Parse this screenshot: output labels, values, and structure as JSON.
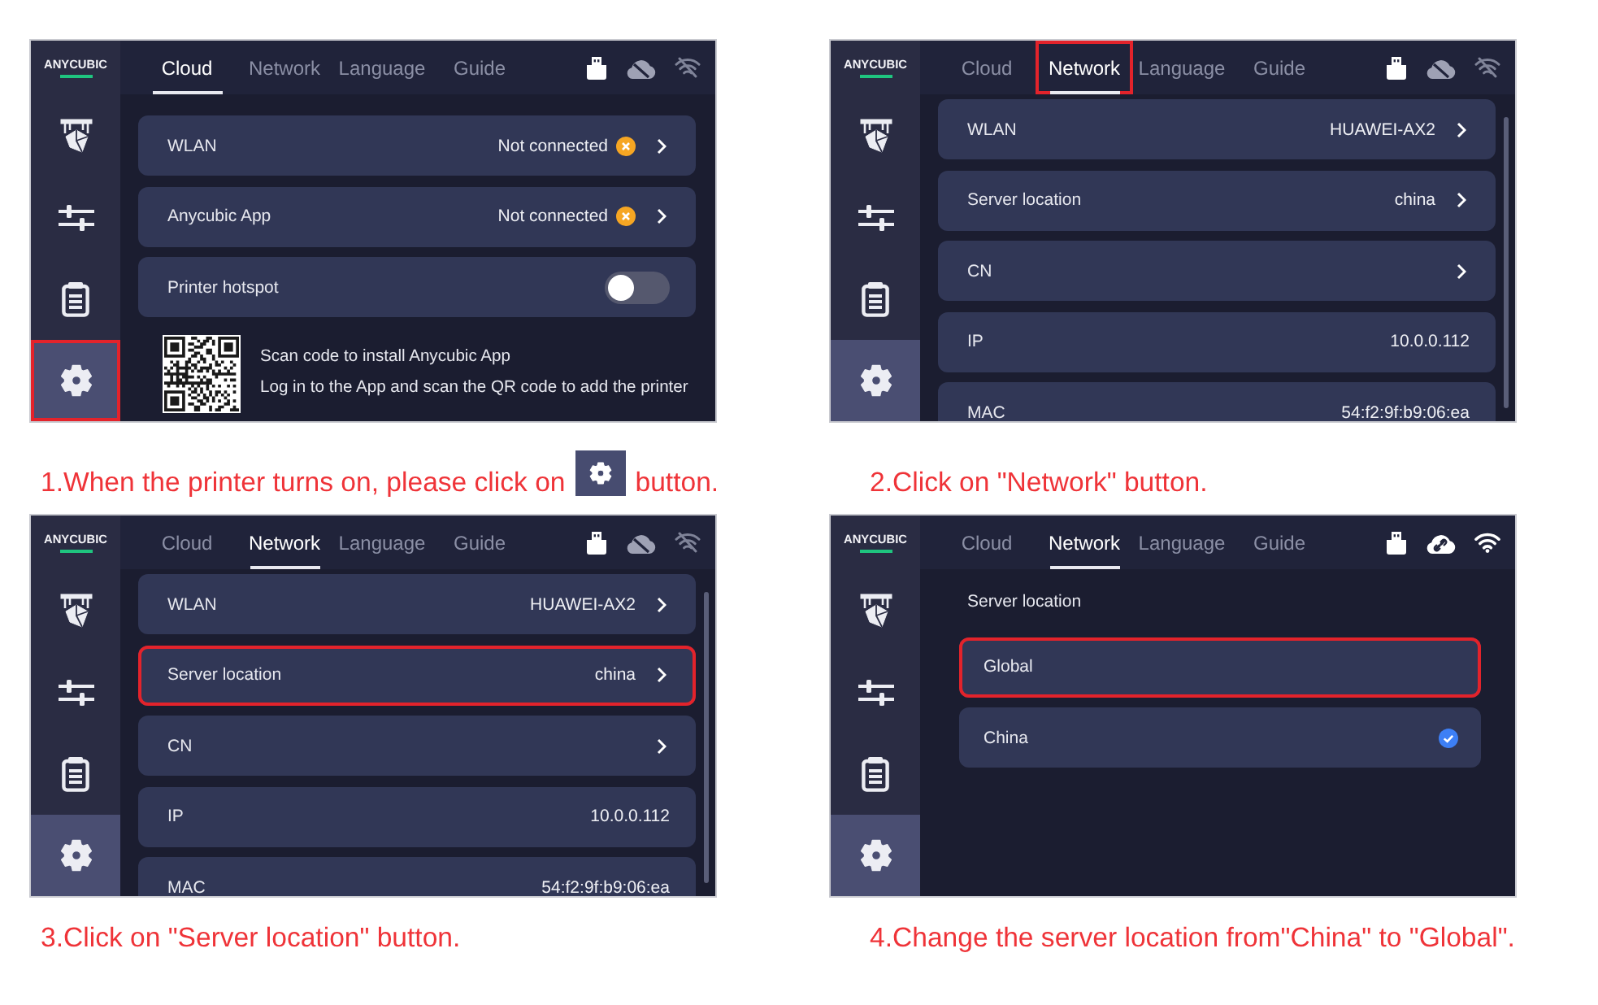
{
  "steps": [
    {
      "screen": {
        "logo": "ANYCUBIC",
        "sidebar": [
          {
            "selected": false,
            "highlighted": false
          },
          {
            "selected": false,
            "highlighted": false
          },
          {
            "selected": false,
            "highlighted": false
          },
          {
            "selected": true,
            "highlighted": true
          }
        ],
        "tabs": [
          {
            "label": "Cloud",
            "selected": true,
            "highlighted": false
          },
          {
            "label": "Network",
            "selected": false,
            "highlighted": false
          },
          {
            "label": "Language",
            "selected": false,
            "highlighted": false
          },
          {
            "label": "Guide",
            "selected": false,
            "highlighted": false
          }
        ],
        "status": {
          "cloud_connected": false,
          "wifi_connected": false
        },
        "scrollbar": false,
        "items": [
          {
            "kind": "link",
            "label": "WLAN",
            "value": "Not connected",
            "alert": true,
            "highlighted": false
          },
          {
            "kind": "link",
            "label": "Anycubic App",
            "value": "Not connected",
            "alert": true,
            "highlighted": false
          },
          {
            "kind": "toggle",
            "label": "Printer hotspot",
            "on": false
          },
          {
            "kind": "qr",
            "lines": [
              "Scan code to install Anycubic App",
              "Log in to the App and scan the QR code to add the printer"
            ]
          }
        ]
      },
      "caption": {
        "parts": [
          {
            "kind": "text",
            "text": "1.When the printer turns on, please click on"
          },
          {
            "kind": "icon"
          },
          {
            "kind": "text",
            "text": "button."
          }
        ]
      }
    },
    {
      "screen": {
        "logo": "ANYCUBIC",
        "sidebar": [
          {
            "selected": false,
            "highlighted": false
          },
          {
            "selected": false,
            "highlighted": false
          },
          {
            "selected": false,
            "highlighted": false
          },
          {
            "selected": true,
            "highlighted": false
          }
        ],
        "tabs": [
          {
            "label": "Cloud",
            "selected": false,
            "highlighted": false
          },
          {
            "label": "Network",
            "selected": true,
            "highlighted": true
          },
          {
            "label": "Language",
            "selected": false,
            "highlighted": false
          },
          {
            "label": "Guide",
            "selected": false,
            "highlighted": false
          }
        ],
        "status": {
          "cloud_connected": false,
          "wifi_connected": false
        },
        "scrollbar": true,
        "items": [
          {
            "kind": "link",
            "label": "WLAN",
            "value": "HUAWEI-AX2",
            "alert": false,
            "highlighted": false
          },
          {
            "kind": "link",
            "label": "Server location",
            "value": "china",
            "alert": false,
            "highlighted": false
          },
          {
            "kind": "link",
            "label": "CN",
            "alert": false,
            "highlighted": false
          },
          {
            "kind": "info",
            "label": "IP",
            "value": "10.0.0.112",
            "alert": false,
            "highlighted": false
          },
          {
            "kind": "info",
            "label": "MAC",
            "value": "54:f2:9f:b9:06:ea",
            "alert": false,
            "highlighted": false
          }
        ]
      },
      "caption": {
        "parts": [
          {
            "kind": "text",
            "text": "2.Click on \"Network\" button."
          }
        ]
      }
    },
    {
      "screen": {
        "logo": "ANYCUBIC",
        "sidebar": [
          {
            "selected": false,
            "highlighted": false
          },
          {
            "selected": false,
            "highlighted": false
          },
          {
            "selected": false,
            "highlighted": false
          },
          {
            "selected": true,
            "highlighted": false
          }
        ],
        "tabs": [
          {
            "label": "Cloud",
            "selected": false,
            "highlighted": false
          },
          {
            "label": "Network",
            "selected": true,
            "highlighted": false
          },
          {
            "label": "Language",
            "selected": false,
            "highlighted": false
          },
          {
            "label": "Guide",
            "selected": false,
            "highlighted": false
          }
        ],
        "status": {
          "cloud_connected": false,
          "wifi_connected": false
        },
        "scrollbar": true,
        "items": [
          {
            "kind": "link",
            "label": "WLAN",
            "value": "HUAWEI-AX2",
            "alert": false,
            "highlighted": false
          },
          {
            "kind": "link",
            "label": "Server location",
            "value": "china",
            "alert": false,
            "highlighted": true
          },
          {
            "kind": "link",
            "label": "CN",
            "alert": false,
            "highlighted": false
          },
          {
            "kind": "info",
            "label": "IP",
            "value": "10.0.0.112",
            "alert": false,
            "highlighted": false
          },
          {
            "kind": "info",
            "label": "MAC",
            "value": "54:f2:9f:b9:06:ea",
            "alert": false,
            "highlighted": false
          }
        ]
      },
      "caption": {
        "parts": [
          {
            "kind": "text",
            "text": "3.Click on \"Server location\" button."
          }
        ]
      }
    },
    {
      "screen": {
        "logo": "ANYCUBIC",
        "sidebar": [
          {
            "selected": false,
            "highlighted": false
          },
          {
            "selected": false,
            "highlighted": false
          },
          {
            "selected": false,
            "highlighted": false
          },
          {
            "selected": true,
            "highlighted": false
          }
        ],
        "tabs": [
          {
            "label": "Cloud",
            "selected": false,
            "highlighted": false
          },
          {
            "label": "Network",
            "selected": true,
            "highlighted": false
          },
          {
            "label": "Language",
            "selected": false,
            "highlighted": false
          },
          {
            "label": "Guide",
            "selected": false,
            "highlighted": false
          }
        ],
        "status": {
          "cloud_connected": true,
          "wifi_connected": true
        },
        "scrollbar": false,
        "items": [
          {
            "kind": "heading",
            "label": "Server location"
          },
          {
            "kind": "option",
            "label": "Global",
            "selected": false,
            "highlighted": true
          },
          {
            "kind": "option",
            "label": "China",
            "selected": true,
            "highlighted": false
          }
        ]
      },
      "caption": {
        "parts": [
          {
            "kind": "text",
            "text": "4.Change the server location from\"China\" to \"Global\"."
          }
        ]
      }
    }
  ]
}
